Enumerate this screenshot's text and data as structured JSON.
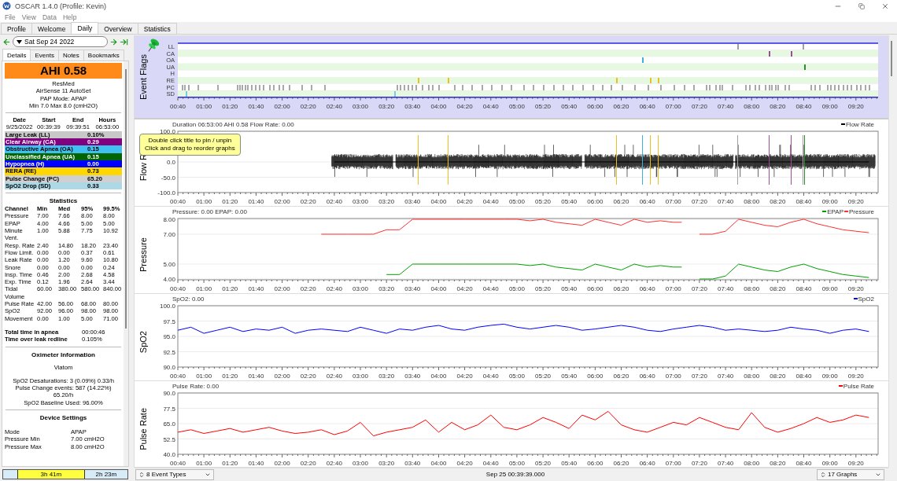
{
  "window": {
    "title": "OSCAR 1.4.0 (Profile: Kevin)"
  },
  "menu": [
    "File",
    "View",
    "Data",
    "Help"
  ],
  "tabs": [
    {
      "label": "Profile",
      "selected": false
    },
    {
      "label": "Welcome",
      "selected": false
    },
    {
      "label": "Daily",
      "selected": true
    },
    {
      "label": "Overview",
      "selected": false
    },
    {
      "label": "Statistics",
      "selected": false
    }
  ],
  "date_nav": {
    "date": "Sat Sep 24 2022"
  },
  "left_panel": {
    "tabs": [
      {
        "label": "Details",
        "selected": true
      },
      {
        "label": "Events",
        "selected": false
      },
      {
        "label": "Notes",
        "selected": false
      },
      {
        "label": "Bookmarks",
        "selected": false
      }
    ],
    "ahi": "AHI 0.58",
    "machine": [
      "ResMed",
      "AirSense 11 AutoSet",
      "PAP Mode: APAP",
      "Min 7.0 Max 8.0 (cmH2O)"
    ],
    "session": {
      "columns": [
        "Date",
        "Start",
        "End",
        "Hours"
      ],
      "values": [
        "9/25/2022",
        "00:39:39",
        "09:39:51",
        "06:53:00"
      ]
    },
    "indices": [
      {
        "label": "Large Leak (LL)",
        "value": "0.10%",
        "color": "#c8c8c8"
      },
      {
        "label": "Clear Airway (CA)",
        "value": "0.29",
        "color": "#800080"
      },
      {
        "label": "Obstructive Apnea (OA)",
        "value": "0.15",
        "color": "#40c0f0"
      },
      {
        "label": "Unclassified Apnea (UA)",
        "value": "0.15",
        "color": "#006400"
      },
      {
        "label": "Hypopnea (H)",
        "value": "0.00",
        "color": "#0000ff"
      },
      {
        "label": "RERA (RE)",
        "value": "0.73",
        "color": "#ffd700"
      },
      {
        "label": "Pulse Change (PC)",
        "value": "65.20",
        "color": "#d0d0d0"
      },
      {
        "label": "SpO2 Drop (SD)",
        "value": "0.33",
        "color": "#add8e6"
      }
    ],
    "statistics": {
      "title": "Statistics",
      "columns": [
        "Channel",
        "Min",
        "Med",
        "95%",
        "99.5%"
      ],
      "rows": [
        [
          "Pressure",
          "7.00",
          "7.66",
          "8.00",
          "8.00"
        ],
        [
          "EPAP",
          "4.00",
          "4.66",
          "5.00",
          "5.00"
        ],
        [
          "Minute Vent.",
          "1.00",
          "5.88",
          "7.75",
          "10.92"
        ],
        [
          "Resp. Rate",
          "2.40",
          "14.80",
          "18.20",
          "23.40"
        ],
        [
          "Flow Limit.",
          "0.00",
          "0.00",
          "0.37",
          "0.61"
        ],
        [
          "Leak Rate",
          "0.00",
          "1.20",
          "9.60",
          "10.80"
        ],
        [
          "Snore",
          "0.00",
          "0.00",
          "0.00",
          "0.24"
        ],
        [
          "Insp. Time",
          "0.46",
          "2.00",
          "2.68",
          "4.58"
        ],
        [
          "Exp. Time",
          "0.12",
          "1.96",
          "2.64",
          "3.44"
        ],
        [
          "Tidal Volume",
          "60.00",
          "380.00",
          "580.00",
          "840.00"
        ],
        [
          "Pulse Rate",
          "42.00",
          "56.00",
          "68.00",
          "80.00"
        ],
        [
          "SpO2",
          "92.00",
          "96.00",
          "98.00",
          "98.00"
        ],
        [
          "Movement",
          "0.00",
          "1.00",
          "5.00",
          "71.00"
        ]
      ]
    },
    "summary": [
      {
        "label": "Total time in apnea",
        "value": "00:00:46"
      },
      {
        "label": "Time over leak redline",
        "value": "0.105%"
      }
    ],
    "oximeter": {
      "title": "Oximeter Information",
      "device": "Viatom",
      "lines": [
        "SpO2 Desaturations: 3 (0.09%) 0.33/h",
        "Pulse Change events: 587 (14.22%) 65.20/h",
        "SpO2 Baseline Used: 96.00%"
      ]
    },
    "device_settings": {
      "title": "Device Settings",
      "rows": [
        {
          "label": "Mode",
          "value": "APAP"
        },
        {
          "label": "Pressure Min",
          "value": "7.00 cmH2O"
        },
        {
          "label": "Pressure Max",
          "value": "8.00 cmH2O"
        }
      ]
    }
  },
  "session_bar": [
    {
      "label": "3h 41m",
      "selected": true
    },
    {
      "label": "2h 23m",
      "selected": false
    }
  ],
  "event_flags": {
    "title": "Event Flags",
    "xticks": [
      "00:40",
      "01:00",
      "01:20",
      "01:40",
      "02:00",
      "02:20",
      "02:40",
      "03:00",
      "03:20",
      "03:40",
      "04:00",
      "04:20",
      "04:40",
      "05:00",
      "05:20",
      "05:40",
      "06:00",
      "06:20",
      "06:40",
      "07:00",
      "07:20",
      "07:40",
      "08:00",
      "08:20",
      "08:40",
      "09:00",
      "09:20"
    ],
    "rows": [
      {
        "label": "LL",
        "color": "#a0a0a0"
      },
      {
        "label": "CA",
        "color": "#9b4f96"
      },
      {
        "label": "OA",
        "color": "#40b0e0"
      },
      {
        "label": "UA",
        "color": "#2e8b2e"
      },
      {
        "label": "H"
      },
      {
        "label": "RE",
        "color": "#e8c020"
      },
      {
        "label": "PC",
        "color": "#a8a8a8"
      },
      {
        "label": "SD",
        "color": "#80c8e0"
      }
    ]
  },
  "tooltip": {
    "lines": [
      "Double click title to pin / unpin",
      "Click and drag to reorder graphs"
    ]
  },
  "graphs": [
    {
      "header": "Duration 06:53:00 AHI 0.58 Flow Rate: 0.00",
      "waveform": true,
      "chart_data": {
        "type": "line",
        "ylabel": "Flow R",
        "grid": true,
        "xlim": [
          40,
          577
        ],
        "ylim": [
          -100,
          100
        ],
        "xticks": [
          {
            "value": 40,
            "label": "00:40"
          },
          {
            "value": 60,
            "label": "01:00"
          },
          {
            "value": 80,
            "label": "01:20"
          },
          {
            "value": 100,
            "label": "01:40"
          },
          {
            "value": 120,
            "label": "02:00"
          },
          {
            "value": 140,
            "label": "02:20"
          },
          {
            "value": 160,
            "label": "02:40"
          },
          {
            "value": 180,
            "label": "03:00"
          },
          {
            "value": 200,
            "label": "03:20"
          },
          {
            "value": 220,
            "label": "03:40"
          },
          {
            "value": 240,
            "label": "04:00"
          },
          {
            "value": 260,
            "label": "04:20"
          },
          {
            "value": 280,
            "label": "04:40"
          },
          {
            "value": 300,
            "label": "05:00"
          },
          {
            "value": 320,
            "label": "05:20"
          },
          {
            "value": 340,
            "label": "05:40"
          },
          {
            "value": 360,
            "label": "06:00"
          },
          {
            "value": 380,
            "label": "06:20"
          },
          {
            "value": 400,
            "label": "06:40"
          },
          {
            "value": 420,
            "label": "07:00"
          },
          {
            "value": 440,
            "label": "07:20"
          },
          {
            "value": 460,
            "label": "07:40"
          },
          {
            "value": 480,
            "label": "08:00"
          },
          {
            "value": 500,
            "label": "08:20"
          },
          {
            "value": 520,
            "label": "08:40"
          },
          {
            "value": 540,
            "label": "09:00"
          },
          {
            "value": 560,
            "label": "09:20"
          }
        ],
        "yticks": [
          {
            "value": 100,
            "label": "100.0"
          },
          {
            "value": 0,
            "label": "0.0"
          },
          {
            "value": -50,
            "label": "-50.0"
          },
          {
            "value": -100,
            "label": "-100.0"
          }
        ],
        "x": [
          160,
          170,
          180,
          190,
          200,
          210,
          220,
          230,
          240,
          250,
          260,
          270,
          280,
          290,
          300,
          310,
          320,
          330,
          340,
          350,
          360,
          370,
          380,
          390,
          400,
          410,
          420,
          430,
          440,
          450,
          460,
          470,
          480,
          490,
          500,
          510,
          520,
          530,
          540,
          550,
          560,
          570
        ],
        "series": [
          {
            "name": "Flow Rate",
            "color": "#000000",
            "values": [
              0,
              0,
              0,
              0,
              0,
              0,
              0,
              0,
              0,
              0,
              0,
              0,
              0,
              0,
              0,
              0,
              0,
              0,
              0,
              0,
              0,
              0,
              0,
              0,
              0,
              0,
              0,
              0,
              0,
              0,
              0,
              0,
              0,
              0,
              0,
              0,
              0,
              0,
              0,
              0,
              0,
              0
            ]
          }
        ],
        "ref_lines": [
          {
            "axis": "x",
            "value": 469,
            "color": "#a0a0a0"
          },
          {
            "axis": "x",
            "value": 519,
            "color": "#a0a0a0"
          },
          {
            "axis": "x",
            "value": 493,
            "color": "#9b4f96"
          },
          {
            "axis": "x",
            "value": 510,
            "color": "#9b4f96"
          },
          {
            "axis": "x",
            "value": 396,
            "color": "#40b0e0"
          },
          {
            "axis": "x",
            "value": 520,
            "color": "#2e8b2e"
          },
          {
            "axis": "x",
            "value": 224,
            "color": "#e8c020"
          },
          {
            "axis": "x",
            "value": 247,
            "color": "#e8c020"
          },
          {
            "axis": "x",
            "value": 376,
            "color": "#e8c020"
          },
          {
            "axis": "x",
            "value": 402,
            "color": "#e8c020"
          },
          {
            "axis": "x",
            "value": 408,
            "color": "#e8c020"
          }
        ]
      }
    },
    {
      "header": "Pressure: 0.00 EPAP: 0.00",
      "chart_data": {
        "type": "line",
        "ylabel": "Pressure",
        "grid": true,
        "xlim": [
          40,
          577
        ],
        "ylim": [
          3.95,
          8.05
        ],
        "xticks": [
          {
            "value": 40,
            "label": "00:40"
          },
          {
            "value": 60,
            "label": "01:00"
          },
          {
            "value": 80,
            "label": "01:20"
          },
          {
            "value": 100,
            "label": "01:40"
          },
          {
            "value": 120,
            "label": "02:00"
          },
          {
            "value": 140,
            "label": "02:20"
          },
          {
            "value": 160,
            "label": "02:40"
          },
          {
            "value": 180,
            "label": "03:00"
          },
          {
            "value": 200,
            "label": "03:20"
          },
          {
            "value": 220,
            "label": "03:40"
          },
          {
            "value": 240,
            "label": "04:00"
          },
          {
            "value": 260,
            "label": "04:20"
          },
          {
            "value": 280,
            "label": "04:40"
          },
          {
            "value": 300,
            "label": "05:00"
          },
          {
            "value": 320,
            "label": "05:20"
          },
          {
            "value": 340,
            "label": "05:40"
          },
          {
            "value": 360,
            "label": "06:00"
          },
          {
            "value": 380,
            "label": "06:20"
          },
          {
            "value": 400,
            "label": "06:40"
          },
          {
            "value": 420,
            "label": "07:00"
          },
          {
            "value": 440,
            "label": "07:20"
          },
          {
            "value": 460,
            "label": "07:40"
          },
          {
            "value": 480,
            "label": "08:00"
          },
          {
            "value": 500,
            "label": "08:20"
          },
          {
            "value": 520,
            "label": "08:40"
          },
          {
            "value": 540,
            "label": "09:00"
          },
          {
            "value": 560,
            "label": "09:20"
          }
        ],
        "yticks": [
          {
            "value": 8,
            "label": "8.00"
          },
          {
            "value": 7,
            "label": "7.00"
          },
          {
            "value": 5,
            "label": "5.00"
          },
          {
            "value": 4,
            "label": "4.00"
          }
        ],
        "x": [
          150,
          160,
          170,
          180,
          190,
          200,
          210,
          220,
          230,
          240,
          250,
          260,
          270,
          280,
          290,
          300,
          310,
          320,
          330,
          340,
          350,
          360,
          370,
          380,
          390,
          400,
          410,
          420,
          430,
          440,
          450,
          460,
          470,
          480,
          490,
          500,
          510,
          520,
          530,
          540,
          550,
          560,
          570
        ],
        "series": [
          {
            "name": "EPAP",
            "color": "#00a000",
            "values": [
              null,
              null,
              null,
              null,
              null,
              4.3,
              4.3,
              5.0,
              5.0,
              5.0,
              5.0,
              5.0,
              5.0,
              5.0,
              5.0,
              5.0,
              4.9,
              5.0,
              4.8,
              4.7,
              4.6,
              5.0,
              4.8,
              4.6,
              5.0,
              4.8,
              4.9,
              4.8,
              null,
              4.0,
              4.0,
              4.2,
              5.0,
              4.8,
              4.6,
              4.5,
              4.8,
              5.0,
              4.7,
              4.5,
              4.3,
              4.2,
              4.1
            ]
          },
          {
            "name": "Pressure",
            "color": "#ff3030",
            "values": [
              7.0,
              7.0,
              7.0,
              7.0,
              7.0,
              7.3,
              7.3,
              8.0,
              8.0,
              8.0,
              8.0,
              8.0,
              8.0,
              8.0,
              8.0,
              8.0,
              7.9,
              8.0,
              7.8,
              7.7,
              7.6,
              8.0,
              7.8,
              7.6,
              8.0,
              7.8,
              7.9,
              7.8,
              null,
              7.0,
              7.0,
              7.2,
              8.0,
              7.8,
              7.6,
              7.5,
              7.8,
              8.0,
              7.7,
              7.5,
              7.3,
              7.2,
              7.1
            ]
          }
        ]
      }
    },
    {
      "header": "SpO2: 0.00",
      "chart_data": {
        "type": "line",
        "ylabel": "SpO2",
        "grid": true,
        "xlim": [
          40,
          577
        ],
        "ylim": [
          90,
          100
        ],
        "xticks": [
          {
            "value": 40,
            "label": "00:40"
          },
          {
            "value": 60,
            "label": "01:00"
          },
          {
            "value": 80,
            "label": "01:20"
          },
          {
            "value": 100,
            "label": "01:40"
          },
          {
            "value": 120,
            "label": "02:00"
          },
          {
            "value": 140,
            "label": "02:20"
          },
          {
            "value": 160,
            "label": "02:40"
          },
          {
            "value": 180,
            "label": "03:00"
          },
          {
            "value": 200,
            "label": "03:20"
          },
          {
            "value": 220,
            "label": "03:40"
          },
          {
            "value": 240,
            "label": "04:00"
          },
          {
            "value": 260,
            "label": "04:20"
          },
          {
            "value": 280,
            "label": "04:40"
          },
          {
            "value": 300,
            "label": "05:00"
          },
          {
            "value": 320,
            "label": "05:20"
          },
          {
            "value": 340,
            "label": "05:40"
          },
          {
            "value": 360,
            "label": "06:00"
          },
          {
            "value": 380,
            "label": "06:20"
          },
          {
            "value": 400,
            "label": "06:40"
          },
          {
            "value": 420,
            "label": "07:00"
          },
          {
            "value": 440,
            "label": "07:20"
          },
          {
            "value": 460,
            "label": "07:40"
          },
          {
            "value": 480,
            "label": "08:00"
          },
          {
            "value": 500,
            "label": "08:20"
          },
          {
            "value": 520,
            "label": "08:40"
          },
          {
            "value": 540,
            "label": "09:00"
          },
          {
            "value": 560,
            "label": "09:20"
          }
        ],
        "yticks": [
          {
            "value": 100,
            "label": "100.0"
          },
          {
            "value": 97.5,
            "label": "97.5"
          },
          {
            "value": 95,
            "label": "95.0"
          },
          {
            "value": 92.5,
            "label": "92.5"
          },
          {
            "value": 90,
            "label": "90.0"
          }
        ],
        "x": [
          40,
          50,
          60,
          70,
          80,
          90,
          100,
          110,
          120,
          130,
          140,
          150,
          160,
          170,
          180,
          190,
          200,
          210,
          220,
          230,
          240,
          250,
          260,
          270,
          280,
          290,
          300,
          310,
          320,
          330,
          340,
          350,
          360,
          370,
          380,
          390,
          400,
          410,
          420,
          430,
          440,
          450,
          460,
          470,
          480,
          490,
          500,
          510,
          520,
          530,
          540,
          550,
          560,
          570
        ],
        "series": [
          {
            "name": "SpO2",
            "color": "#0000ff",
            "values": [
              96.0,
              96.5,
              95.5,
              96.0,
              96.5,
              95.8,
              96.2,
              96.0,
              96.5,
              95.5,
              96.0,
              96.2,
              96.0,
              95.8,
              96.5,
              96.0,
              95.5,
              96.2,
              96.0,
              96.5,
              96.8,
              96.2,
              96.0,
              96.5,
              96.8,
              97.0,
              96.5,
              96.2,
              96.5,
              96.8,
              96.5,
              96.0,
              96.2,
              96.5,
              96.8,
              96.5,
              96.0,
              95.8,
              96.2,
              96.5,
              96.8,
              96.5,
              96.0,
              96.2,
              96.0,
              95.8,
              96.0,
              96.5,
              96.2,
              96.0,
              95.5,
              96.0,
              96.2,
              95.8
            ]
          }
        ]
      }
    },
    {
      "header": "Pulse Rate: 0.00",
      "chart_data": {
        "type": "line",
        "ylabel": "Pulse Rate",
        "grid": true,
        "xlim": [
          40,
          577
        ],
        "ylim": [
          40,
          90
        ],
        "xticks": [
          {
            "value": 40,
            "label": "00:40"
          },
          {
            "value": 60,
            "label": "01:00"
          },
          {
            "value": 80,
            "label": "01:20"
          },
          {
            "value": 100,
            "label": "01:40"
          },
          {
            "value": 120,
            "label": "02:00"
          },
          {
            "value": 140,
            "label": "02:20"
          },
          {
            "value": 160,
            "label": "02:40"
          },
          {
            "value": 180,
            "label": "03:00"
          },
          {
            "value": 200,
            "label": "03:20"
          },
          {
            "value": 220,
            "label": "03:40"
          },
          {
            "value": 240,
            "label": "04:00"
          },
          {
            "value": 260,
            "label": "04:20"
          },
          {
            "value": 280,
            "label": "04:40"
          },
          {
            "value": 300,
            "label": "05:00"
          },
          {
            "value": 320,
            "label": "05:20"
          },
          {
            "value": 340,
            "label": "05:40"
          },
          {
            "value": 360,
            "label": "06:00"
          },
          {
            "value": 380,
            "label": "06:20"
          },
          {
            "value": 400,
            "label": "06:40"
          },
          {
            "value": 420,
            "label": "07:00"
          },
          {
            "value": 440,
            "label": "07:20"
          },
          {
            "value": 460,
            "label": "07:40"
          },
          {
            "value": 480,
            "label": "08:00"
          },
          {
            "value": 500,
            "label": "08:20"
          },
          {
            "value": 520,
            "label": "08:40"
          },
          {
            "value": 540,
            "label": "09:00"
          },
          {
            "value": 560,
            "label": "09:20"
          }
        ],
        "yticks": [
          {
            "value": 90,
            "label": "90.0"
          },
          {
            "value": 77.5,
            "label": "77.5"
          },
          {
            "value": 65,
            "label": "65.0"
          },
          {
            "value": 52.5,
            "label": "52.5"
          },
          {
            "value": 40,
            "label": "40.0"
          }
        ],
        "x": [
          40,
          50,
          60,
          70,
          80,
          90,
          100,
          110,
          120,
          130,
          140,
          150,
          160,
          170,
          180,
          190,
          200,
          210,
          220,
          230,
          240,
          250,
          260,
          270,
          280,
          290,
          300,
          310,
          320,
          330,
          340,
          350,
          360,
          370,
          380,
          390,
          400,
          410,
          420,
          430,
          440,
          450,
          460,
          470,
          480,
          490,
          500,
          510,
          520,
          530,
          540,
          550,
          560,
          570
        ],
        "series": [
          {
            "name": "Pulse Rate",
            "color": "#ff0000",
            "values": [
              58,
              60,
              57,
              59,
              61,
              58,
              60,
              62,
              59,
              57,
              58,
              60,
              56,
              59,
              66,
              55,
              58,
              60,
              62,
              68,
              58,
              66,
              60,
              64,
              72,
              62,
              60,
              64,
              70,
              66,
              61,
              72,
              68,
              75,
              64,
              60,
              58,
              62,
              66,
              64,
              70,
              66,
              62,
              60,
              74,
              62,
              58,
              61,
              65,
              70,
              66,
              68,
              72,
              70
            ]
          }
        ]
      }
    }
  ],
  "status_bar": {
    "event_types": "8 Event Types",
    "time": "Sep 25 00:39:39.000",
    "graphs": "17 Graphs"
  }
}
